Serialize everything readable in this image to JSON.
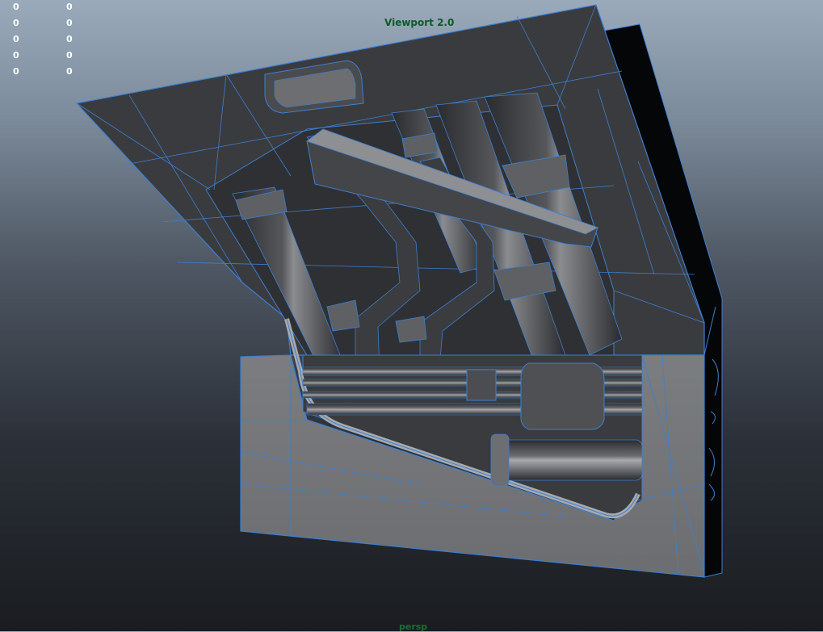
{
  "viewport": {
    "title": "Viewport 2.0",
    "camera": "persp"
  },
  "hud_stats": [
    {
      "a": "0",
      "b": "0"
    },
    {
      "a": "0",
      "b": "0"
    },
    {
      "a": "0",
      "b": "0"
    },
    {
      "a": "0",
      "b": "0"
    },
    {
      "a": "0",
      "b": "0"
    }
  ],
  "colors": {
    "wireframe": "#3d7fd1",
    "mesh_dark": "#3a3b3e",
    "mesh_light": "#7a7b7e",
    "label_green": "#0d5a2a"
  }
}
